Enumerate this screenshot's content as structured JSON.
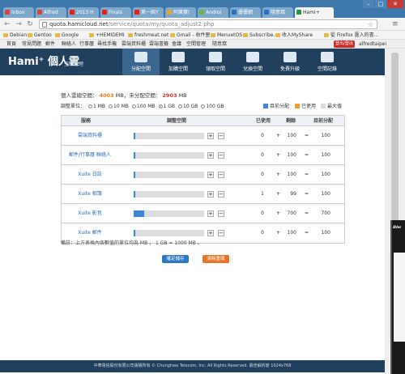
{
  "browser": {
    "tabs": [
      {
        "title": "Inbox",
        "color": "#d9433b"
      },
      {
        "title": "Alfred",
        "color": "#d9433b"
      },
      {
        "title": "2013 H",
        "color": "#e62117"
      },
      {
        "title": "Finals",
        "color": "#e62117"
      },
      {
        "title": "第一屆Y",
        "color": "#e62117"
      },
      {
        "title": "阿樂實(",
        "color": "#e0a52f"
      },
      {
        "title": "Androi",
        "color": "#6bb34a"
      },
      {
        "title": "優優網",
        "color": "#2b6fc0"
      },
      {
        "title": "隨意窩",
        "color": "#2b6fc0"
      },
      {
        "title": "Hami+",
        "color": "#2a8f4c"
      }
    ],
    "url_host": "quota.hamicloud.net",
    "url_path": "/service/quota/my/quota_adjust2.php",
    "bookmarks": [
      "Debian",
      "Gentoo",
      "Google",
      "+HEMIDEMI",
      "freshmeat.net",
      "Gmail - 收件匣",
      "MenuetOS",
      "Subscribe...",
      "收入MyShare",
      "從 Firefox 匯入的書..."
    ]
  },
  "site_nav": {
    "links": [
      "首頁",
      "常見問題",
      "郵件",
      "聯絡人",
      "行事曆",
      "尋找手機",
      "雲端資料櫃",
      "雲端書籤",
      "會議",
      "空間管理",
      "隨意窩"
    ],
    "logout_label": "登出/登出",
    "username": "alfredtaipei"
  },
  "header": {
    "logo_text": "Hami⁺ 個人雲",
    "logo_sub": "空間管理",
    "menu": [
      {
        "label": "分配空間",
        "active": true
      },
      {
        "label": "加購空間",
        "active": false
      },
      {
        "label": "領取空間",
        "active": false
      },
      {
        "label": "兌換空間",
        "active": false
      },
      {
        "label": "免費升級",
        "active": false
      },
      {
        "label": "空間記錄",
        "active": false
      }
    ]
  },
  "summary": {
    "total_label": "個人雲總空間：",
    "total_value": "4003",
    "total_unit": "MB，未分配空間：",
    "unassigned_value": "2903",
    "unassigned_unit": "MB"
  },
  "units": {
    "label": "調整單位：",
    "options": [
      "1 MB",
      "10 MB",
      "100 MB",
      "1 GB",
      "10 GB",
      "100 GB"
    ],
    "selected": "1 GB"
  },
  "legend": [
    {
      "label": "目前分配",
      "color": "#3a88d6"
    },
    {
      "label": "已使用",
      "color": "#f0a030"
    },
    {
      "label": "最大值",
      "color": "#dcdcdc"
    }
  ],
  "table": {
    "headers": {
      "service": "服務",
      "adjust": "調整空間",
      "used": "已使用",
      "remaining": "剩餘",
      "allocated": "目前分配"
    },
    "rows": [
      {
        "service": "雲端資料櫃",
        "fill": 0.02,
        "used": "0",
        "plus": "+",
        "remaining": "100",
        "eq": "=",
        "allocated": "100"
      },
      {
        "service": "郵件/行事曆 聯絡人",
        "fill": 0.02,
        "used": "0",
        "plus": "+",
        "remaining": "100",
        "eq": "=",
        "allocated": "100"
      },
      {
        "service": "Xuite 日誌",
        "fill": 0.02,
        "used": "0",
        "plus": "+",
        "remaining": "100",
        "eq": "=",
        "allocated": "100"
      },
      {
        "service": "Xuite 相簿",
        "fill": 0.02,
        "used": "1",
        "plus": "+",
        "remaining": "99",
        "eq": "=",
        "allocated": "100"
      },
      {
        "service": "Xuite 影音",
        "fill": 0.15,
        "used": "0",
        "plus": "+",
        "remaining": "700",
        "eq": "=",
        "allocated": "700"
      },
      {
        "service": "Xuite 郵件",
        "fill": 0.02,
        "used": "0",
        "plus": "+",
        "remaining": "100",
        "eq": "=",
        "allocated": "100"
      }
    ]
  },
  "note": "備註：上方表格內各數值的單位均為 MB ， 1 GB = 1000 MB 。",
  "buttons": {
    "save": "確定儲存",
    "reset": "清除重填"
  },
  "footer": "中華電信股份有限公司版權所有 © Chunghwa Telecom, Inc. All Rights Reserved. 最佳解析度 1024x768",
  "overlay_brand": "AVer"
}
